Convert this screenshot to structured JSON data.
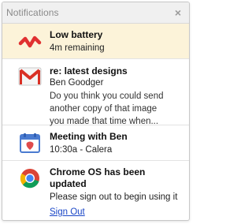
{
  "header": {
    "title": "Notifications",
    "close_glyph": "×"
  },
  "notifications": [
    {
      "icon": "low-battery-icon",
      "title": "Low battery",
      "line": "4m remaining"
    },
    {
      "icon": "gmail-icon",
      "title": "re: latest designs",
      "sender": "Ben Goodger",
      "message": "Do you think you could send another copy of that image you made that time when..."
    },
    {
      "icon": "calendar-icon",
      "title": "Meeting with Ben",
      "line": "10:30a - Calera"
    },
    {
      "icon": "chrome-icon",
      "title": "Chrome OS has been updated",
      "line": "Please sign out to begin using it",
      "link": "Sign Out"
    }
  ],
  "colors": {
    "alert_bg": "#fcf3d9",
    "link": "#1a46c7",
    "battery_red": "#e03131"
  }
}
